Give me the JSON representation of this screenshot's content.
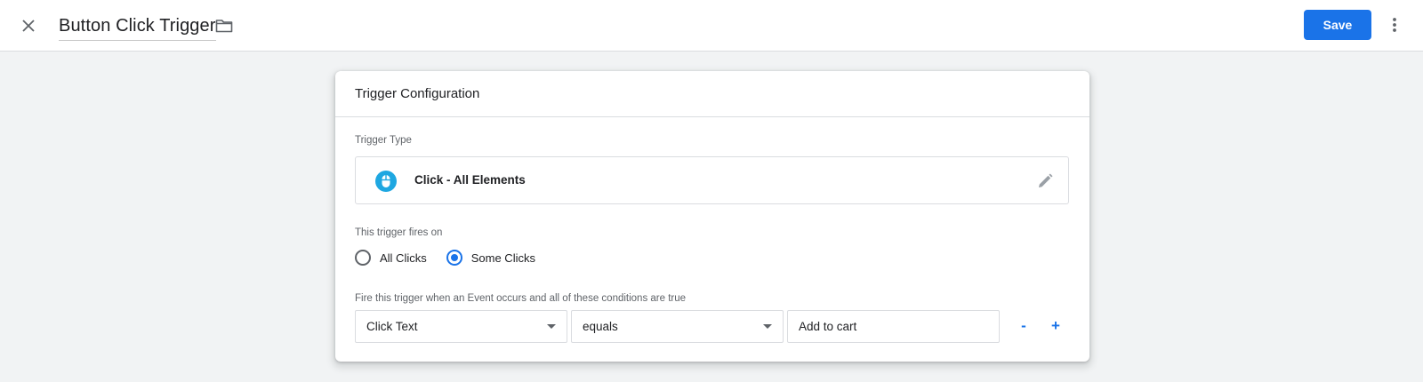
{
  "header": {
    "title": "Button Click Trigger",
    "save_label": "Save",
    "close_icon": "close-icon",
    "folder_icon": "folder-icon",
    "more_icon": "more-vert-icon"
  },
  "card": {
    "title": "Trigger Configuration",
    "trigger_type_label": "Trigger Type",
    "trigger_type_name": "Click - All Elements",
    "trigger_type_icon": "mouse-icon",
    "edit_icon": "pencil-icon",
    "fires_on_label": "This trigger fires on",
    "radio_options": [
      {
        "label": "All Clicks",
        "checked": false
      },
      {
        "label": "Some Clicks",
        "checked": true
      }
    ],
    "conditions_label": "Fire this trigger when an Event occurs and all of these conditions are true",
    "condition": {
      "variable": "Click Text",
      "operator": "equals",
      "value": "Add to cart"
    },
    "remove_label": "-",
    "add_label": "+"
  },
  "colors": {
    "accent": "#1a73e8",
    "trigger_icon": "#1ea7e1",
    "background": "#f1f3f4"
  }
}
